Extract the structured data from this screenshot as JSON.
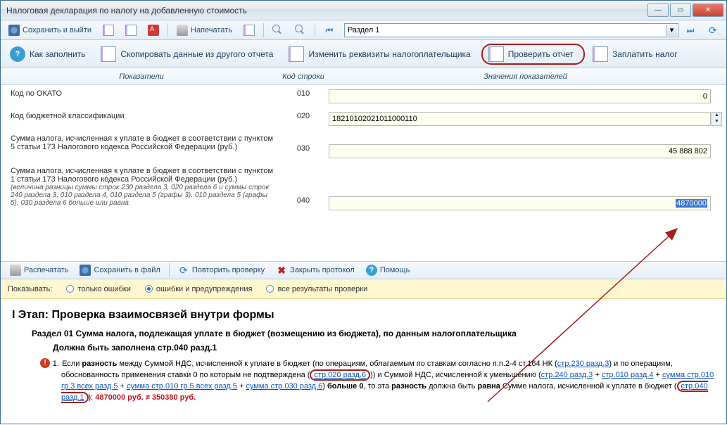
{
  "window": {
    "title": "Налоговая декларация по налогу на добавленную стоимость"
  },
  "toolbar1": {
    "save_exit": "Сохранить и выйти",
    "print": "Напечатать",
    "section": "Раздел 1"
  },
  "toolbar2": {
    "how_fill": "Как заполнить",
    "copy_from": "Скопировать данные из другого отчета",
    "change_req": "Изменить реквизиты налогоплательщика",
    "check_report": "Проверить отчет",
    "pay_tax": "Заплатить налог"
  },
  "grid": {
    "headers": {
      "ind": "Показатели",
      "code": "Код строки",
      "val": "Значения показателей"
    },
    "rows": [
      {
        "label": "Код по ОКАТО",
        "note": "",
        "code": "010",
        "value": "0",
        "align": "right",
        "spin": false
      },
      {
        "label": "Код бюджетной классификации",
        "note": "",
        "code": "020",
        "value": "18210102021011000110",
        "align": "left",
        "spin": true
      },
      {
        "label": "Сумма налога, исчисленная к уплате в бюджет в соответствии с пунктом 5 статьи 173 Налогового кодекса Российской Федерации (руб.)",
        "note": "",
        "code": "030",
        "value": "45 888 802",
        "align": "right",
        "spin": false
      },
      {
        "label": "Сумма налога, исчисленная к уплате в бюджет в соответствии с пунктом 1 статьи 173 Налогового кодекса Российской Федерации (руб.)",
        "note": "(величина разницы суммы строк 230 раздела 3, 020 раздела 6 и суммы строк 240 раздела 3, 010 раздела 4, 010 раздела 5 (графы 3), 010 раздела 5 (графы 5), 030 раздела 6 больше или равна",
        "code": "040",
        "value": "4870000",
        "align": "right",
        "spin": false,
        "selected": true
      }
    ]
  },
  "toolbar3": {
    "print": "Распечатать",
    "save_file": "Сохранить в файл",
    "repeat_check": "Повторить проверку",
    "close_proto": "Закрыть протокол",
    "help": "Помощь"
  },
  "filter": {
    "label": "Показывать:",
    "opt_errors": "только ошибки",
    "opt_warn": "ошибки и предупреждения",
    "opt_all": "все результаты проверки"
  },
  "results": {
    "stage_title": "I Этап: Проверка взаимосвязей внутри формы",
    "section_title": "Раздел 01 Сумма налога, подлежащая уплате в бюджет (возмещению из бюджета), по данным налогоплательщика",
    "must_filled": "Должна быть заполнена стр.040 разд.1",
    "item_prefix": "Если ",
    "word_diff": "разность",
    "txt1": " между Суммой НДС, исчисленной к уплате в бюджет (по операциям, облагаемым по ставкам согласно п.п.2-4 ст.164 НК (",
    "lnk1": "стр.230 разд.3",
    "txt2": ") и по операциям, обоснованность применения ставки 0 по которым не подтверждена (",
    "lnk2": "стр.020 разд.6",
    "txt3": ")) и Суммой НДС, исчисленной к уменьшению (",
    "lnk3": "стр.240 разд.3",
    "plus": " + ",
    "lnk4": "стр.010 разд.4",
    "lnk5": "сумма стр.010 гр.3 всех разд.5",
    "lnk6": "сумма стр.010 гр.5 всех разд.5",
    "lnk7": "сумма стр.030 разд.6",
    "txt4": ") ",
    "word_more0": "больше 0",
    "txt5": ", то эта ",
    "txt6": " должна быть ",
    "word_eq": "равна",
    "txt7": " Сумме налога, исчисленной к уплате в бюджет (",
    "lnk8": "стр.040 разд.1",
    "txt8": "): ",
    "red_result": "4870000 руб. ≠ 350380 руб."
  }
}
